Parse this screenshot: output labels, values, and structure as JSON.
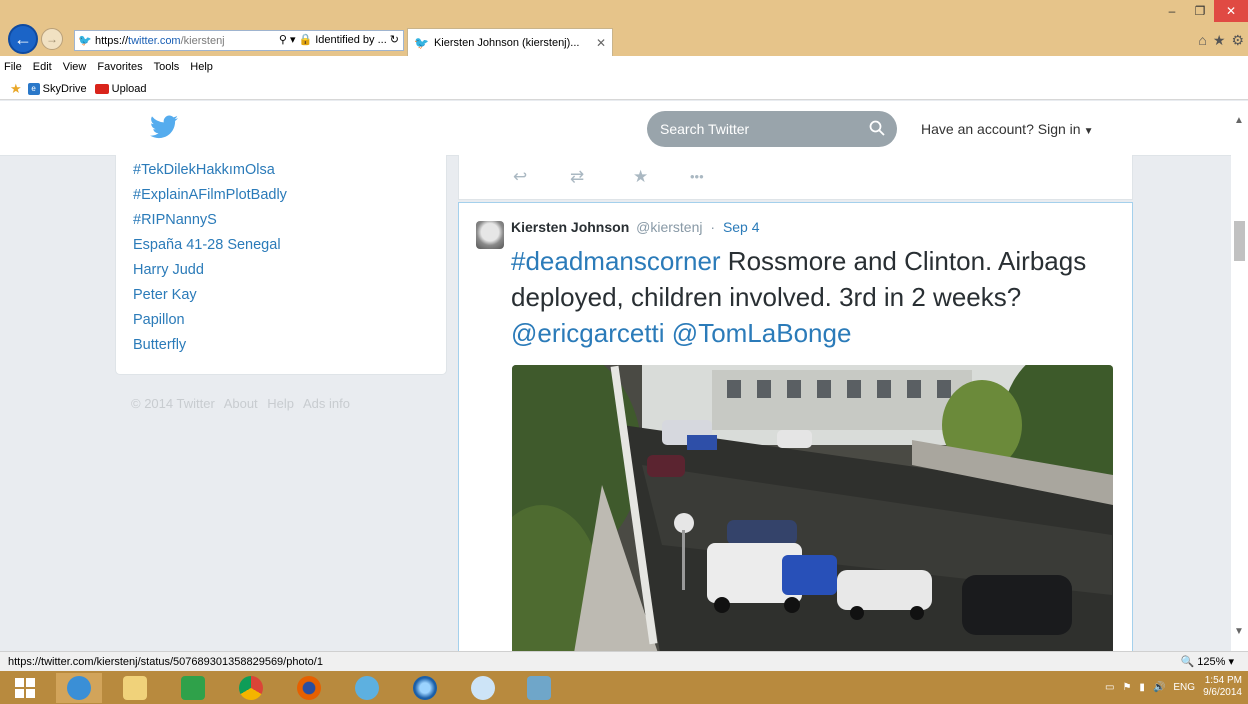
{
  "browser": {
    "url_proto": "https://",
    "url_host": "twitter.com",
    "url_path": "/kierstenj",
    "identity_label": "Identified by ...",
    "tab_title": "Kiersten Johnson (kierstenj)...",
    "menu": [
      "File",
      "Edit",
      "View",
      "Favorites",
      "Tools",
      "Help"
    ],
    "favorites": [
      {
        "label": "SkyDrive",
        "icon": "skydrive-icon"
      },
      {
        "label": "Upload",
        "icon": "youtube-upload-icon"
      }
    ],
    "status_url": "https://twitter.com/kierstenj/status/507689301358829569/photo/1",
    "zoom": "125%"
  },
  "twitter": {
    "search_placeholder": "Search Twitter",
    "signin_label": "Have an account? Sign in",
    "trends": [
      "#TekDilekHakkımOlsa",
      "#ExplainAFilmPlotBadly",
      "#RIPNannyS",
      "España 41-28 Senegal",
      "Harry Judd",
      "Peter Kay",
      "Papillon",
      "Butterfly"
    ],
    "footer": {
      "copyright": "© 2014 Twitter",
      "about": "About",
      "help": "Help",
      "ads": "Ads info"
    },
    "tweet": {
      "name": "Kiersten Johnson",
      "handle": "@kierstenj",
      "separator": "·",
      "date": "Sep 4",
      "hashtag": "#deadmanscorner",
      "text_1": " Rossmore and Clinton. Airbags deployed, children involved. 3rd in 2 weeks? ",
      "mention_1": "@ericgarcetti",
      "mention_2": "@TomLaBonge"
    }
  },
  "taskbar": {
    "language": "ENG",
    "time": "1:54 PM",
    "date": "9/6/2014"
  },
  "colors": {
    "twitter_blue": "#2b7bb9",
    "chrome_tan": "#e6c48a",
    "taskbar": "#b88a3e"
  }
}
